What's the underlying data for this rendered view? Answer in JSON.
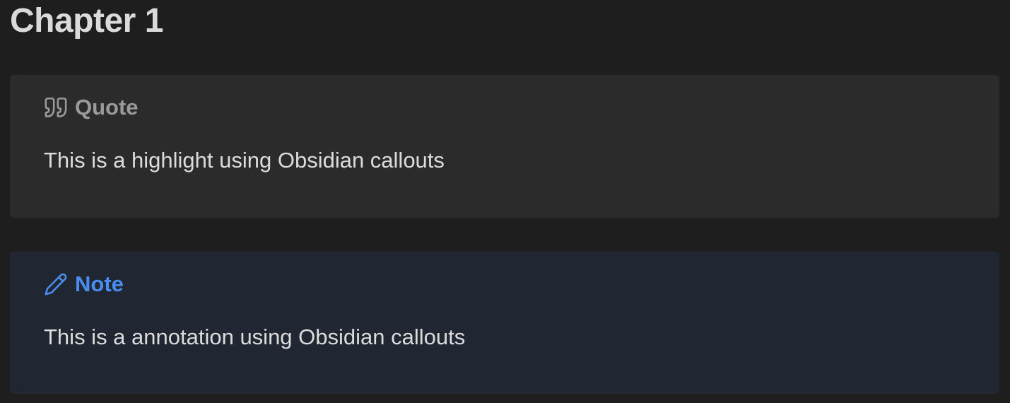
{
  "heading": "Chapter 1",
  "callouts": [
    {
      "type": "quote",
      "icon": "quote-icon",
      "title": "Quote",
      "body": "This is a highlight using Obsidian callouts",
      "accent": "#9a9a9a"
    },
    {
      "type": "note",
      "icon": "pencil-icon",
      "title": "Note",
      "body": "This is a annotation using Obsidian callouts",
      "accent": "#4a8df0"
    }
  ]
}
